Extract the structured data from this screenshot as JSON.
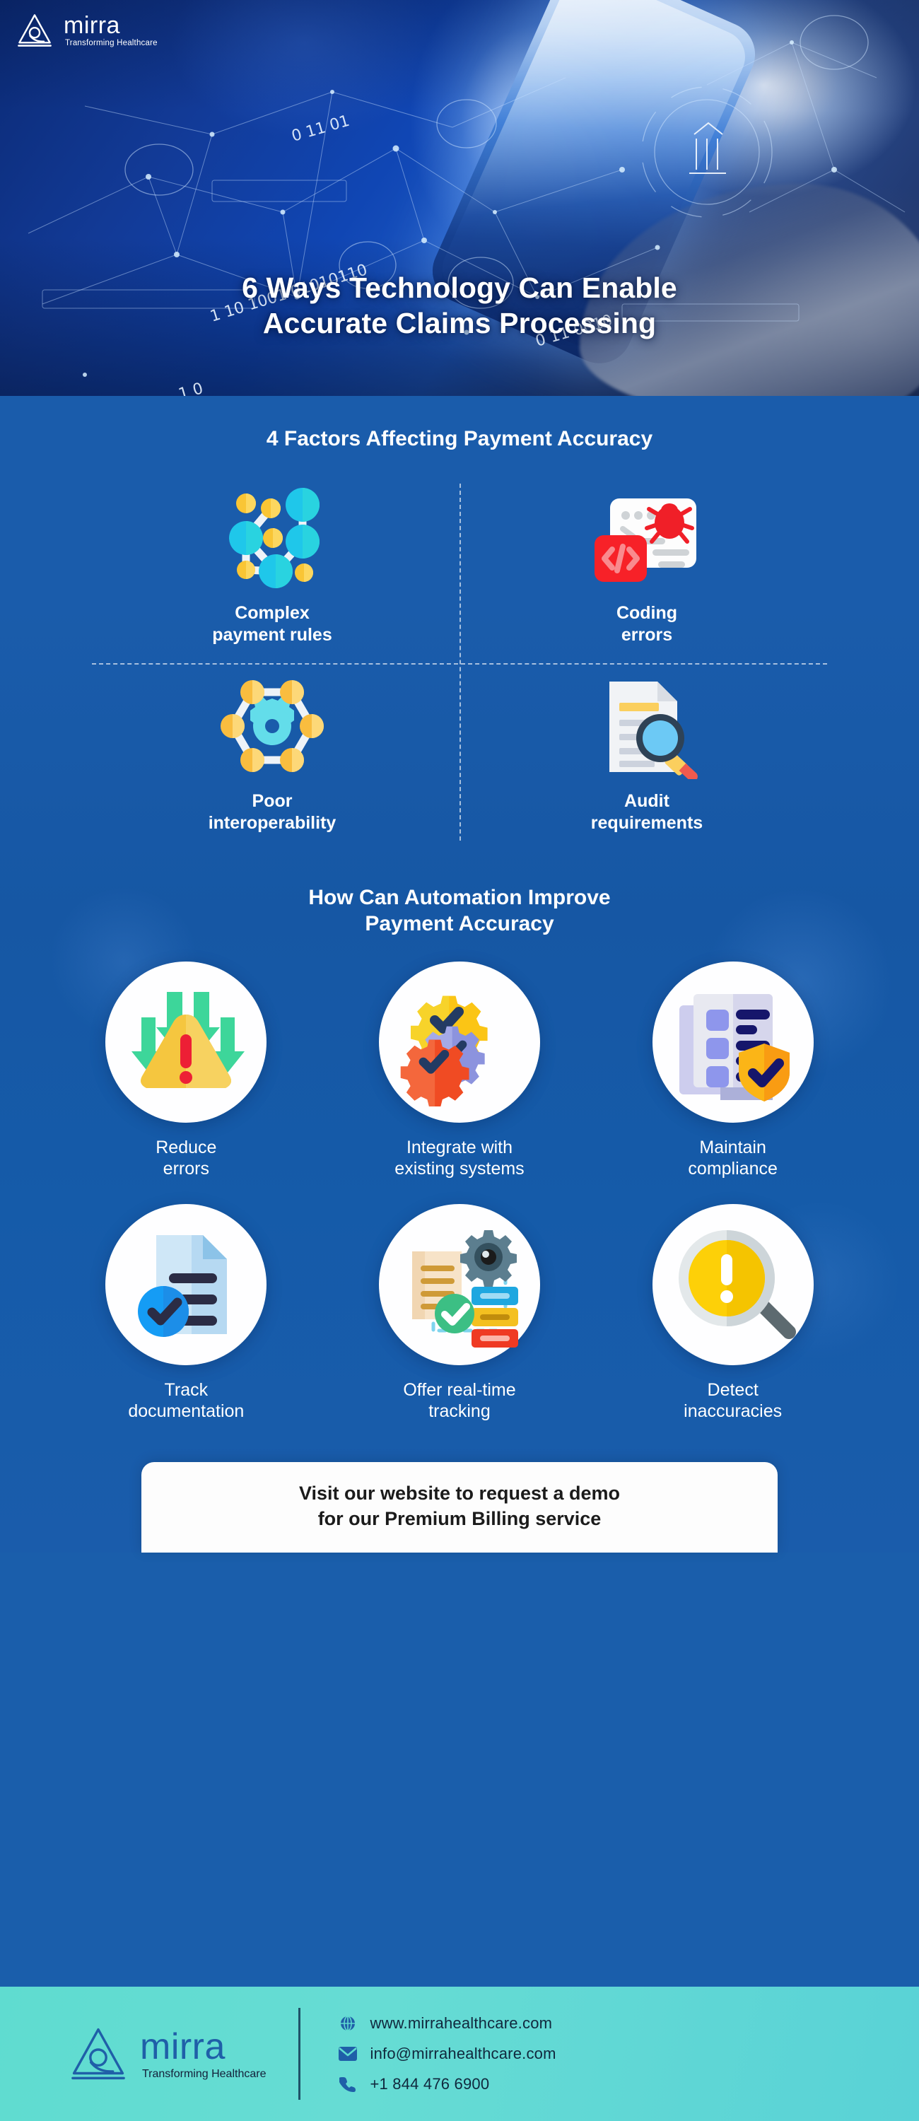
{
  "brand": {
    "name": "mirra",
    "tagline": "Transforming Healthcare",
    "logo_icon": "mirra-triangle-logo-icon",
    "accent_blue": "#1f5fa8",
    "footer_bg": "#5fdcd0"
  },
  "hero": {
    "title_line1": "6 Ways Technology Can Enable",
    "title_line2": "Accurate Claims Processing",
    "background_desc": "hand-using-smartphone-with-digital-network-overlay"
  },
  "factors": {
    "title": "4 Factors Affecting Payment Accuracy",
    "items": [
      {
        "label_line1": "Complex",
        "label_line2": "payment rules",
        "icon": "network-nodes-icon"
      },
      {
        "label_line1": "Coding",
        "label_line2": "errors",
        "icon": "code-window-bug-icon"
      },
      {
        "label_line1": "Poor",
        "label_line2": "interoperability",
        "icon": "hexagon-gear-nodes-icon"
      },
      {
        "label_line1": "Audit",
        "label_line2": "requirements",
        "icon": "document-magnifier-icon"
      }
    ]
  },
  "automation": {
    "title_line1": "How Can Automation Improve",
    "title_line2": "Payment Accuracy",
    "items": [
      {
        "label_line1": "Reduce",
        "label_line2": "errors",
        "icon": "warning-triangle-down-arrows-icon"
      },
      {
        "label_line1": "Integrate with",
        "label_line2": "existing systems",
        "icon": "gears-checkmarks-icon"
      },
      {
        "label_line1": "Maintain",
        "label_line2": "compliance",
        "icon": "checklist-shield-icon"
      },
      {
        "label_line1": "Track",
        "label_line2": "documentation",
        "icon": "document-check-badge-icon"
      },
      {
        "label_line1": "Offer real-time",
        "label_line2": "tracking",
        "icon": "workflow-gear-checkmark-icon"
      },
      {
        "label_line1": "Detect",
        "label_line2": "inaccuracies",
        "icon": "magnifier-alert-icon"
      }
    ]
  },
  "cta": {
    "line1": "Visit our website to request a demo",
    "line2": "for our Premium Billing service"
  },
  "footer": {
    "contacts": [
      {
        "icon": "globe-icon",
        "text": "www.mirrahealthcare.com"
      },
      {
        "icon": "envelope-icon",
        "text": "info@mirrahealthcare.com"
      },
      {
        "icon": "phone-icon",
        "text": "+1 844 476 6900"
      }
    ]
  }
}
